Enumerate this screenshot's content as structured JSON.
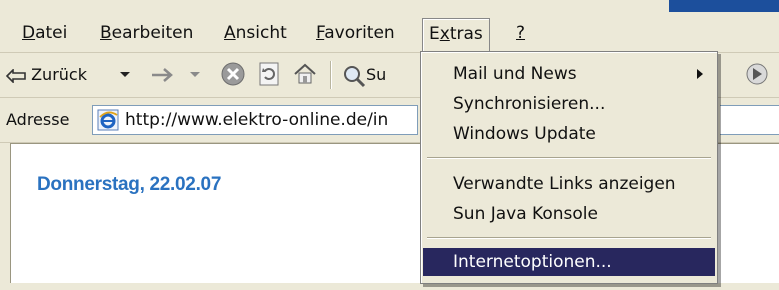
{
  "menubar": {
    "items": [
      {
        "label": "Datei",
        "accel": "D"
      },
      {
        "label": "Bearbeiten",
        "accel": "B"
      },
      {
        "label": "Ansicht",
        "accel": "A"
      },
      {
        "label": "Favoriten",
        "accel": "F"
      },
      {
        "label": "Extras",
        "accel": "x"
      },
      {
        "label": "?",
        "accel": "?"
      }
    ]
  },
  "toolbar": {
    "back_label": "Zurück",
    "search_label_partial": "Su"
  },
  "address": {
    "label": "Adresse",
    "url": "http://www.elektro-online.de/in"
  },
  "page": {
    "date": "Donnerstag, 22.02.07"
  },
  "extras_menu": {
    "items": [
      {
        "label": "Mail und News",
        "submenu": true
      },
      {
        "label": "Synchronisieren..."
      },
      {
        "label": "Windows Update"
      },
      {
        "label": "Verwandte Links anzeigen"
      },
      {
        "label": "Sun Java Konsole"
      },
      {
        "label": "Internetoptionen...",
        "selected": true
      }
    ]
  },
  "colors": {
    "chrome": "#ece9d8",
    "highlight": "#28275e",
    "date_text": "#2a72c0",
    "accent": "#1c4f9c"
  },
  "icons": [
    "back-arrow-icon",
    "dropdown-arrow-icon",
    "forward-arrow-icon",
    "stop-icon",
    "refresh-icon",
    "home-icon",
    "search-icon",
    "ie-page-icon",
    "media-icon"
  ]
}
